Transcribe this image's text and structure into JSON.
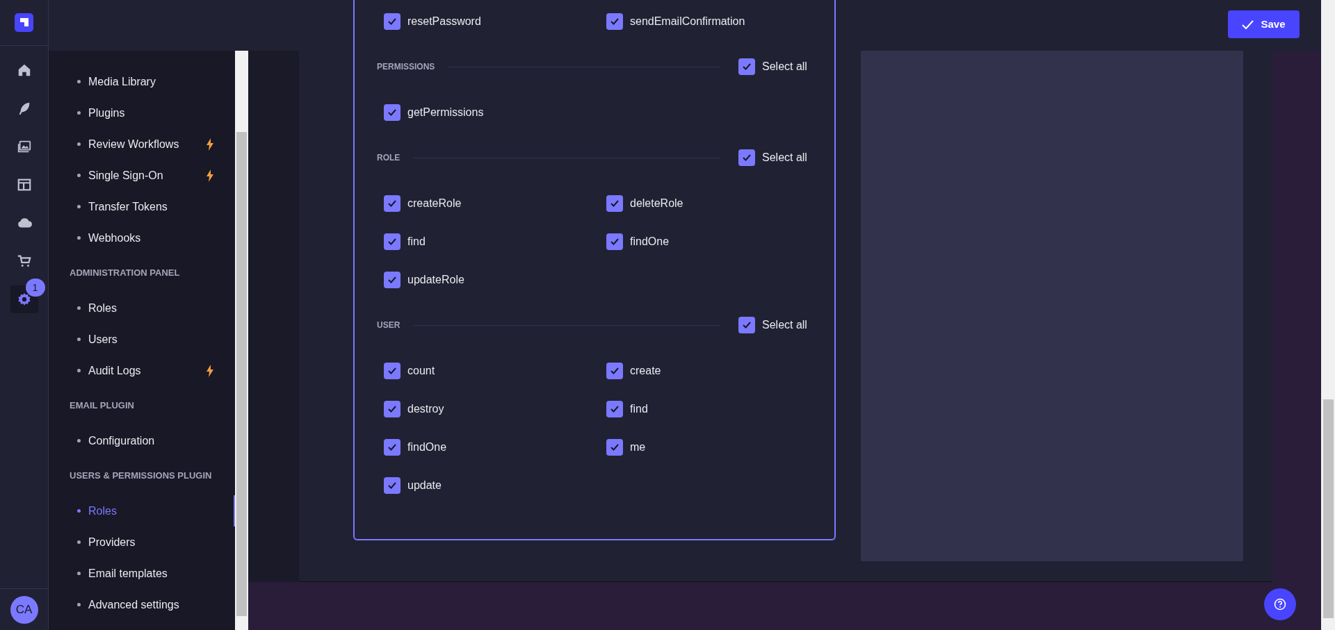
{
  "rail": {
    "items": [
      {
        "kind": "home",
        "selected": false
      },
      {
        "kind": "feather",
        "selected": false
      },
      {
        "kind": "images",
        "selected": false
      },
      {
        "kind": "layout",
        "selected": false
      },
      {
        "kind": "cloud",
        "selected": false
      },
      {
        "kind": "cart",
        "selected": false
      },
      {
        "kind": "settings",
        "selected": true,
        "badge": "1"
      }
    ],
    "avatar": "CA"
  },
  "sidebar": {
    "sections": [
      {
        "items": [
          {
            "label": "Media Library",
            "selected": false,
            "premium": false
          },
          {
            "label": "Plugins",
            "selected": false,
            "premium": false
          },
          {
            "label": "Review Workflows",
            "selected": false,
            "premium": true
          },
          {
            "label": "Single Sign-On",
            "selected": false,
            "premium": true
          },
          {
            "label": "Transfer Tokens",
            "selected": false,
            "premium": false
          },
          {
            "label": "Webhooks",
            "selected": false,
            "premium": false
          }
        ]
      },
      {
        "title": "ADMINISTRATION PANEL",
        "items": [
          {
            "label": "Roles",
            "selected": false,
            "premium": false
          },
          {
            "label": "Users",
            "selected": false,
            "premium": false
          },
          {
            "label": "Audit Logs",
            "selected": false,
            "premium": true
          }
        ]
      },
      {
        "title": "EMAIL PLUGIN",
        "items": [
          {
            "label": "Configuration",
            "selected": false,
            "premium": false
          }
        ]
      },
      {
        "title": "USERS & PERMISSIONS PLUGIN",
        "items": [
          {
            "label": "Roles",
            "selected": true,
            "premium": false
          },
          {
            "label": "Providers",
            "selected": false,
            "premium": false
          },
          {
            "label": "Email templates",
            "selected": false,
            "premium": false
          },
          {
            "label": "Advanced settings",
            "selected": false,
            "premium": false
          }
        ]
      }
    ]
  },
  "header": {
    "save_button": "Save"
  },
  "permissions": {
    "groups": [
      {
        "actions": [
          {
            "label": "resetPassword",
            "checked": true
          },
          {
            "label": "sendEmailConfirmation",
            "checked": true
          }
        ]
      },
      {
        "title": "PERMISSIONS",
        "select_all": {
          "label": "Select all",
          "checked": true
        },
        "actions": [
          {
            "label": "getPermissions",
            "checked": true
          }
        ]
      },
      {
        "title": "ROLE",
        "select_all": {
          "label": "Select all",
          "checked": true
        },
        "actions": [
          {
            "label": "createRole",
            "checked": true
          },
          {
            "label": "deleteRole",
            "checked": true
          },
          {
            "label": "find",
            "checked": true
          },
          {
            "label": "findOne",
            "checked": true
          },
          {
            "label": "updateRole",
            "checked": true
          }
        ]
      },
      {
        "title": "USER",
        "select_all": {
          "label": "Select all",
          "checked": true
        },
        "actions": [
          {
            "label": "count",
            "checked": true
          },
          {
            "label": "create",
            "checked": true
          },
          {
            "label": "destroy",
            "checked": true
          },
          {
            "label": "find",
            "checked": true
          },
          {
            "label": "findOne",
            "checked": true
          },
          {
            "label": "me",
            "checked": true
          },
          {
            "label": "update",
            "checked": true
          }
        ]
      }
    ]
  }
}
